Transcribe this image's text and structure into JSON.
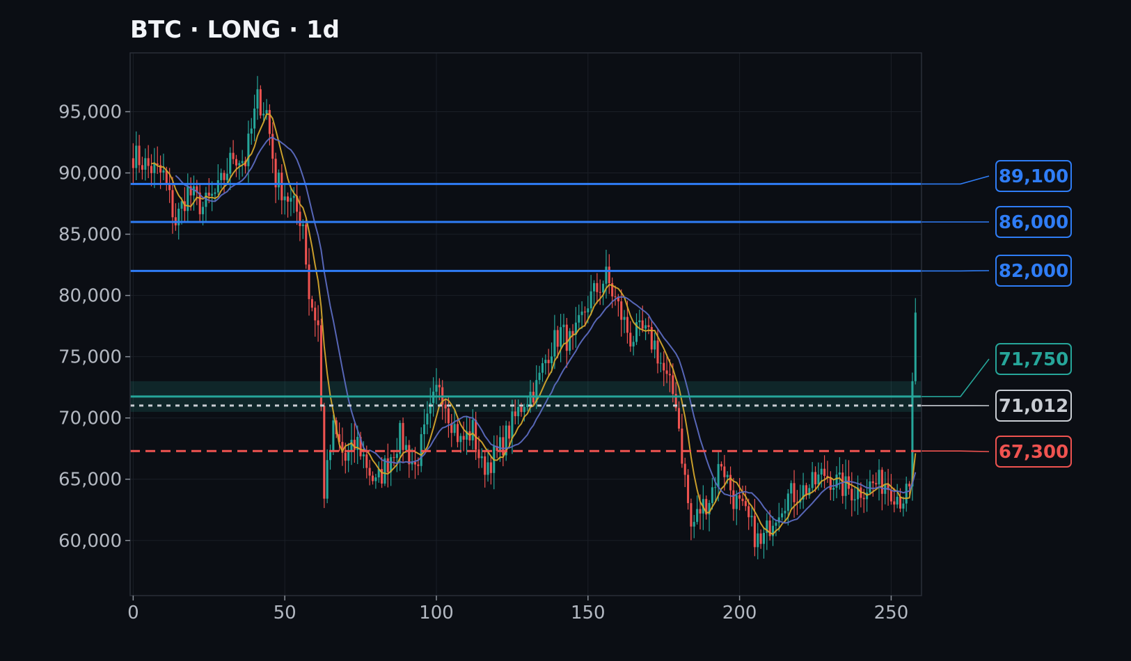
{
  "chart_data": {
    "type": "candlestick",
    "title": "BTC · LONG · 1d",
    "xlabel": "",
    "ylabel": "",
    "xlim": [
      -1,
      260
    ],
    "ylim": [
      55500,
      99800
    ],
    "x_ticks": [
      0,
      50,
      100,
      150,
      200,
      250
    ],
    "y_ticks": [
      60000,
      65000,
      70000,
      75000,
      80000,
      85000,
      90000,
      95000
    ],
    "grid": true,
    "n_candles": 259,
    "colors": {
      "up": "#26a69a",
      "down": "#ef5350",
      "target": "#2f7df6",
      "entry": "#26a69a",
      "last_price": "#c9cdd3",
      "stop": "#ef5350",
      "ma_fast": "#d4a72c",
      "ma_slow": "#5c6bc0",
      "background": "#0b0e14"
    },
    "price_path_anchors": [
      [
        0,
        91500
      ],
      [
        5,
        90500
      ],
      [
        10,
        89800
      ],
      [
        14,
        86000
      ],
      [
        18,
        88500
      ],
      [
        23,
        87200
      ],
      [
        28,
        88500
      ],
      [
        33,
        91500
      ],
      [
        37,
        91000
      ],
      [
        41,
        96000
      ],
      [
        44,
        95000
      ],
      [
        47,
        89500
      ],
      [
        51,
        88000
      ],
      [
        56,
        86000
      ],
      [
        58,
        80000
      ],
      [
        61,
        77500
      ],
      [
        63,
        64000
      ],
      [
        66,
        69000
      ],
      [
        70,
        66500
      ],
      [
        74,
        68000
      ],
      [
        80,
        64500
      ],
      [
        84,
        66500
      ],
      [
        88,
        68500
      ],
      [
        93,
        66000
      ],
      [
        97,
        69500
      ],
      [
        101,
        73000
      ],
      [
        104,
        70500
      ],
      [
        108,
        68000
      ],
      [
        112,
        69000
      ],
      [
        115,
        66000
      ],
      [
        120,
        67000
      ],
      [
        124,
        69000
      ],
      [
        129,
        71500
      ],
      [
        133,
        72500
      ],
      [
        137,
        75500
      ],
      [
        141,
        77000
      ],
      [
        145,
        76000
      ],
      [
        150,
        79500
      ],
      [
        156,
        81500
      ],
      [
        160,
        79000
      ],
      [
        164,
        76500
      ],
      [
        168,
        77000
      ],
      [
        172,
        76000
      ],
      [
        176,
        73000
      ],
      [
        179,
        71500
      ],
      [
        181,
        67000
      ],
      [
        184,
        61000
      ],
      [
        187,
        62500
      ],
      [
        190,
        63500
      ],
      [
        194,
        66500
      ],
      [
        198,
        63500
      ],
      [
        203,
        61500
      ],
      [
        207,
        59500
      ],
      [
        211,
        62000
      ],
      [
        215,
        63500
      ],
      [
        220,
        64000
      ],
      [
        224,
        64500
      ],
      [
        228,
        65500
      ],
      [
        233,
        64500
      ],
      [
        238,
        64000
      ],
      [
        243,
        64500
      ],
      [
        248,
        64800
      ],
      [
        253,
        63500
      ],
      [
        256,
        63800
      ],
      [
        257,
        66500
      ],
      [
        258,
        73000
      ],
      [
        259,
        78500
      ]
    ],
    "series": [
      {
        "name": "",
        "kind": "moving_average",
        "window": 7,
        "color": "#d4a72c"
      },
      {
        "name": "",
        "kind": "moving_average",
        "window": 15,
        "color": "#5c6bc0"
      }
    ],
    "entry_zone": [
      70500,
      73000
    ],
    "levels": [
      {
        "value": 89100,
        "label": "89,100",
        "kind": "target",
        "style": "solid"
      },
      {
        "value": 86000,
        "label": "86,000",
        "kind": "target",
        "style": "solid"
      },
      {
        "value": 82000,
        "label": "82,000",
        "kind": "target",
        "style": "solid"
      },
      {
        "value": 71750,
        "label": "71,750",
        "kind": "entry",
        "style": "solid"
      },
      {
        "value": 71012,
        "label": "71,012",
        "kind": "last_price",
        "style": "dotted"
      },
      {
        "value": 67300,
        "label": "67,300",
        "kind": "stop",
        "style": "dashed"
      }
    ]
  }
}
